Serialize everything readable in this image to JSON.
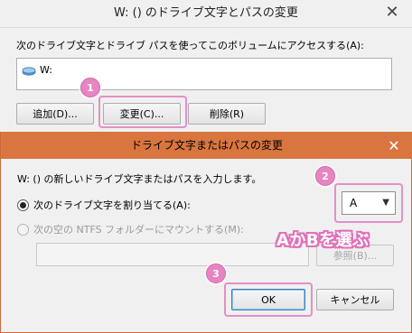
{
  "outer_dialog": {
    "title": "W: () のドライブ文字とパスの変更",
    "close_glyph": "✕",
    "description": "次のドライブ文字とドライブ パスを使ってこのボリュームにアクセスする(A):",
    "drive_item_label": "W:",
    "buttons": {
      "add": "追加(D)...",
      "change": "変更(C)...",
      "delete": "削除(R)"
    }
  },
  "inner_dialog": {
    "title": "ドライブ文字またはパスの変更",
    "close_glyph": "✕",
    "description": "W: () の新しいドライブ文字またはパスを入力します。",
    "assign_option": "次のドライブ文字を割り当てる(A):",
    "mount_option": "次の空の NTFS フォルダーにマウントする(M):",
    "drive_letter_value": "A",
    "browse_button": "参照(B)...",
    "ok_button": "OK",
    "cancel_button": "キャンセル"
  },
  "annotations": {
    "step1": "1",
    "step2": "2",
    "step3": "3",
    "caption": "AかBを選ぶ",
    "highlight_color": "#e685c2"
  },
  "colors": {
    "inner_titlebar": "#d9763f",
    "dialog_bg": "#f0f0f0"
  },
  "icons": {
    "drive": "drive-icon",
    "select_arrow": "chevron-down-icon",
    "close": "close-icon"
  }
}
